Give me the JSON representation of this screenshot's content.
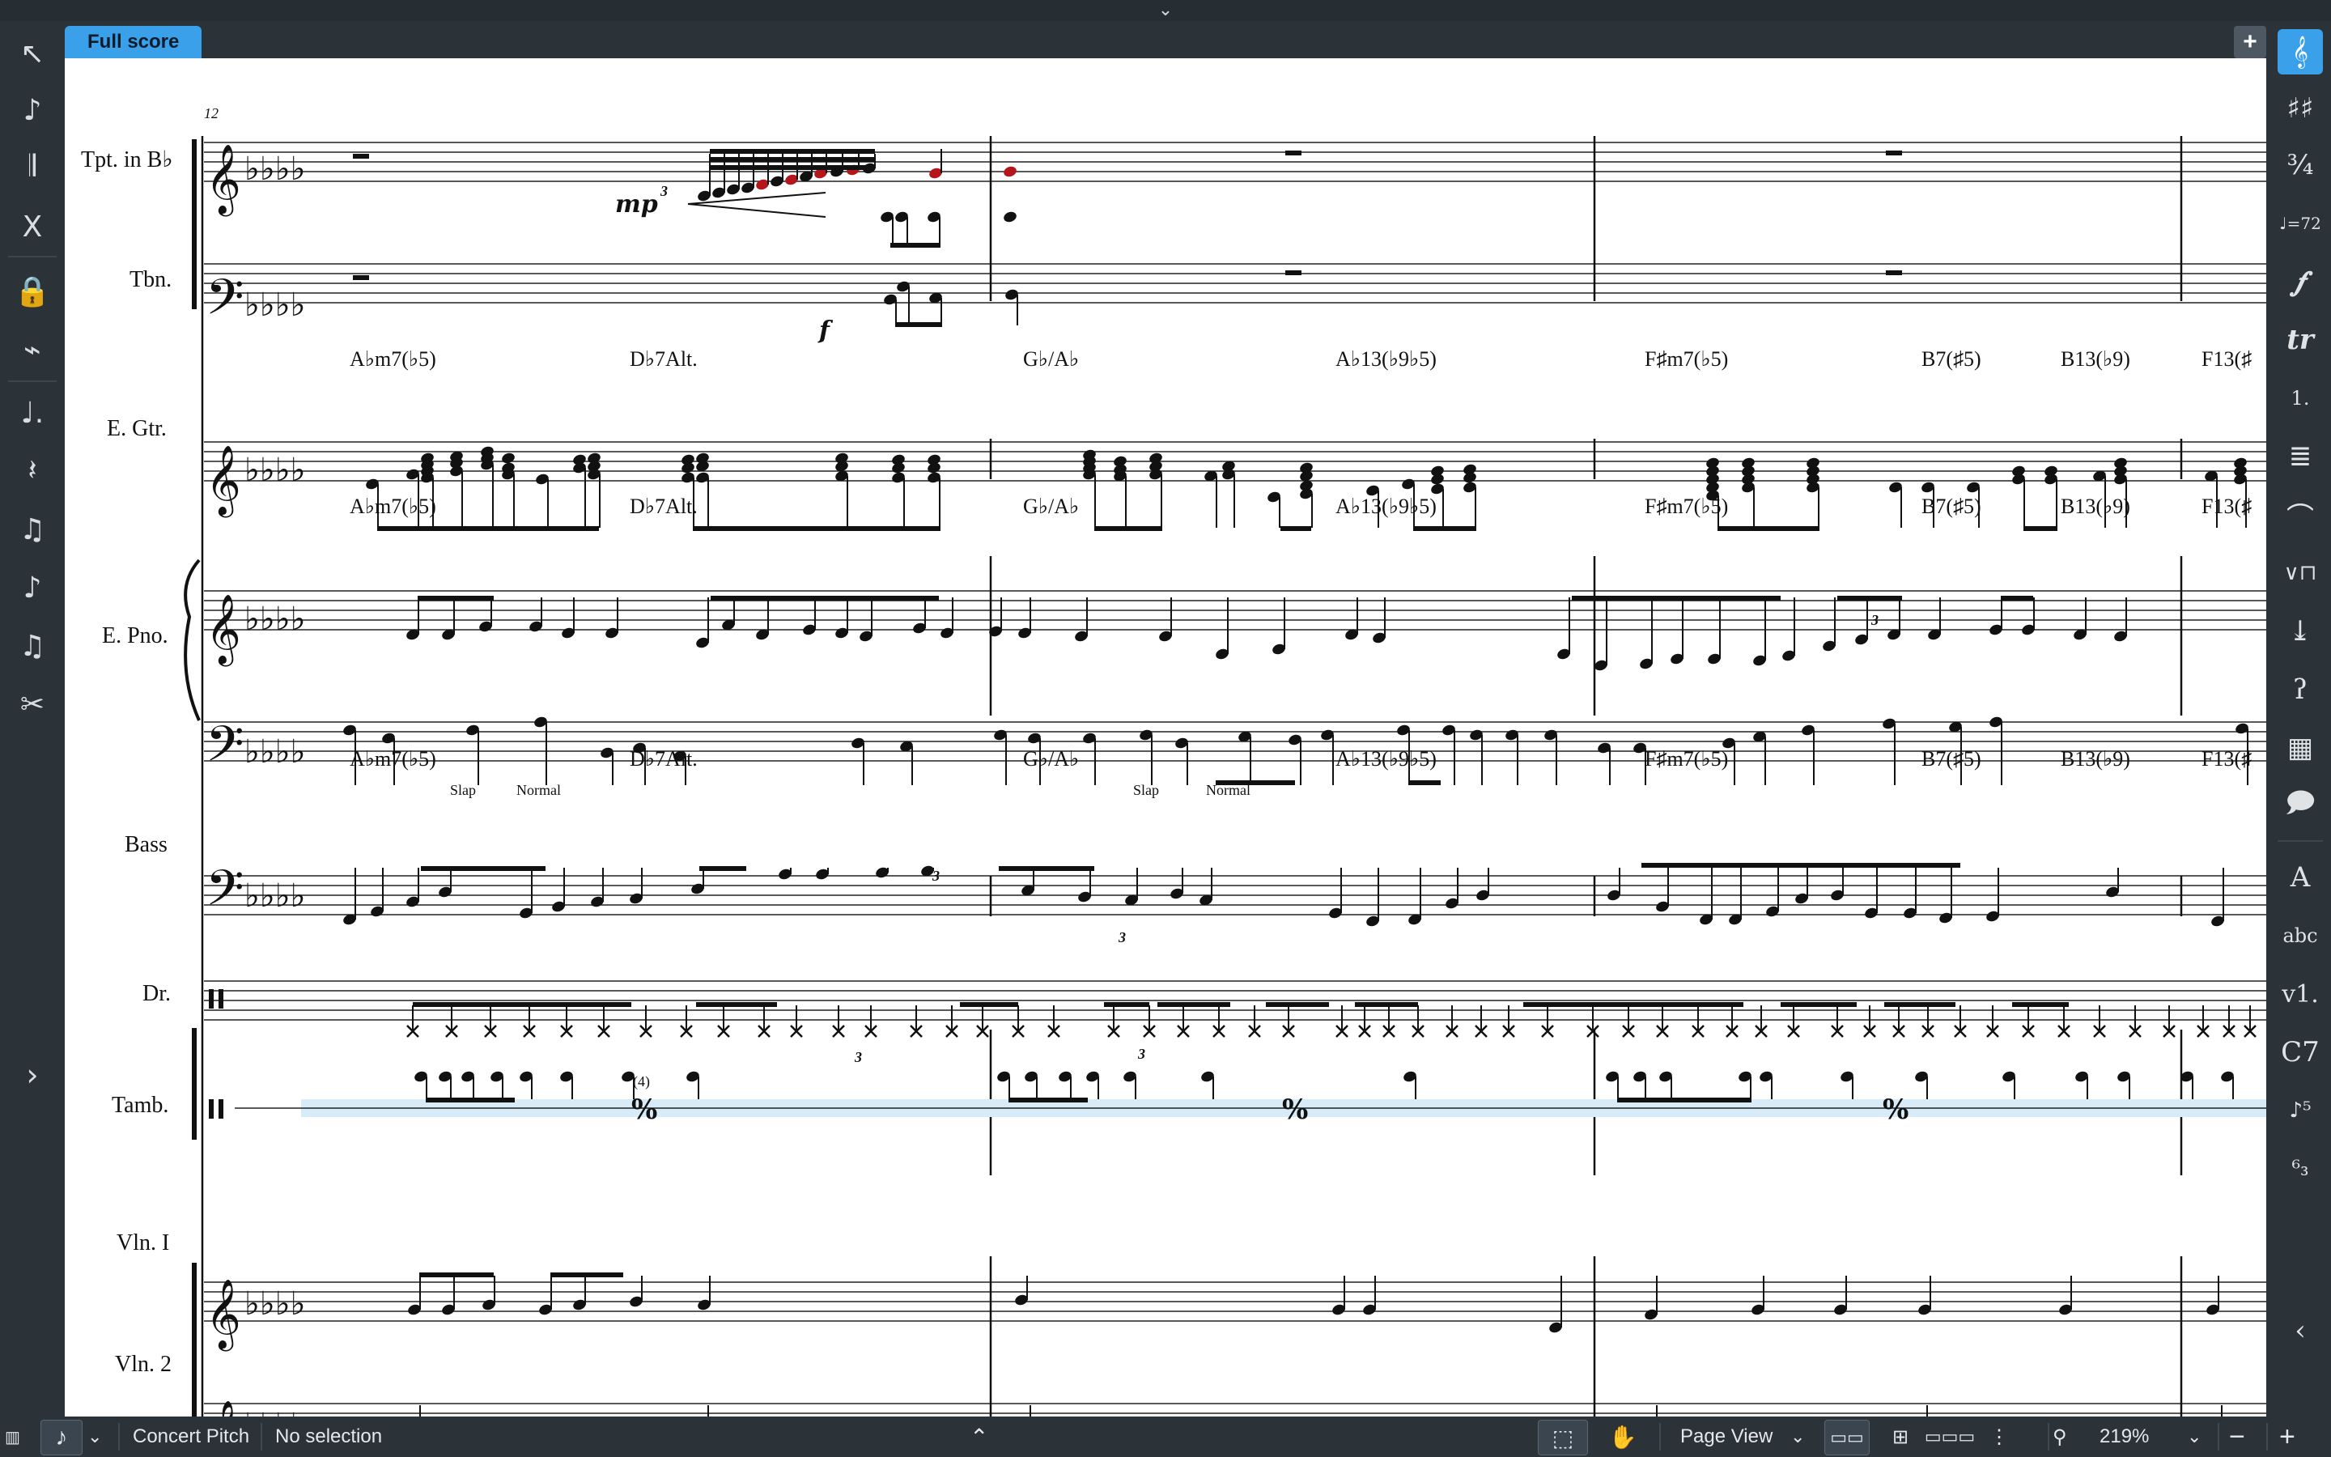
{
  "tabs": {
    "active_label": "Full score",
    "add_label": "+"
  },
  "top_chevron": "⌄",
  "left_toolbar": [
    {
      "name": "select-tool-icon",
      "glyph": "↖"
    },
    {
      "name": "note-input-icon",
      "glyph": "♪"
    },
    {
      "name": "tremolo-icon",
      "glyph": "𝄂"
    },
    {
      "name": "split-stem-icon",
      "glyph": "Ⅹ"
    },
    {
      "name": "lock-duration-icon",
      "glyph": "🔒"
    },
    {
      "name": "pitch-input-icon",
      "glyph": "⌁"
    },
    {
      "name": "dotted-note-icon",
      "glyph": "♩."
    },
    {
      "name": "rest-icon",
      "glyph": "𝄽"
    },
    {
      "name": "tuplet-icon",
      "glyph": "♫"
    },
    {
      "name": "grace-note-icon",
      "glyph": "♪"
    },
    {
      "name": "chord-input-icon",
      "glyph": "♫"
    },
    {
      "name": "scissors-icon",
      "glyph": "✂"
    }
  ],
  "left_expand": "›",
  "right_toolbar": [
    {
      "name": "clef-icon",
      "glyph": "𝄞",
      "active": true
    },
    {
      "name": "key-signature-icon",
      "glyph": "♯♯"
    },
    {
      "name": "time-signature-icon",
      "glyph": "¾"
    },
    {
      "name": "tempo-icon",
      "glyph": "♩=72"
    },
    {
      "name": "dynamics-icon",
      "glyph": "𝆑"
    },
    {
      "name": "ornaments-icon",
      "glyph": "tr"
    },
    {
      "name": "repeat-ending-icon",
      "glyph": "1."
    },
    {
      "name": "bars-icon",
      "glyph": "≣"
    },
    {
      "name": "fermata-icon",
      "glyph": "⌒"
    },
    {
      "name": "bowing-icon",
      "glyph": "∨⊓"
    },
    {
      "name": "cues-icon",
      "glyph": "⤓"
    },
    {
      "name": "playing-techniques-icon",
      "glyph": "ʔ"
    },
    {
      "name": "video-icon",
      "glyph": "▦"
    },
    {
      "name": "comment-icon",
      "glyph": "🗩"
    },
    {
      "name": "text-icon",
      "glyph": "A"
    },
    {
      "name": "lyrics-icon",
      "glyph": "abc"
    },
    {
      "name": "rehearsal-mark-icon",
      "glyph": "v1."
    },
    {
      "name": "chord-symbol-icon",
      "glyph": "C7"
    },
    {
      "name": "fingering-icon",
      "glyph": "♪⁵"
    },
    {
      "name": "figured-bass-icon",
      "glyph": "⁶₃"
    }
  ],
  "right_collapse": "‹",
  "score": {
    "bar_number": "12",
    "instruments": [
      "Tpt. in B♭",
      "Tbn.",
      "E. Gtr.",
      "E. Pno.",
      "Bass",
      "Dr.",
      "Tamb.",
      "Vln. I",
      "Vln. 2"
    ],
    "chord_symbols": [
      "A♭m7(♭5)",
      "D♭7Alt.",
      "G♭/A♭",
      "A♭13(♭9♭5)",
      "F♯m7(♭5)",
      "B7(♯5)",
      "B13(♭9)",
      "F13(♯"
    ],
    "playing_techniques": [
      "Slap",
      "Normal",
      "Slap",
      "Normal"
    ],
    "dynamics": [
      "mp",
      "f"
    ],
    "tuplet_labels": [
      "3",
      "3",
      "3",
      "3",
      "3",
      "3"
    ],
    "bar_repeat_count": "(4)"
  },
  "statusbar": {
    "concert_pitch": "Concert Pitch",
    "selection": "No selection",
    "view_mode": "Page View",
    "zoom": "219%"
  }
}
